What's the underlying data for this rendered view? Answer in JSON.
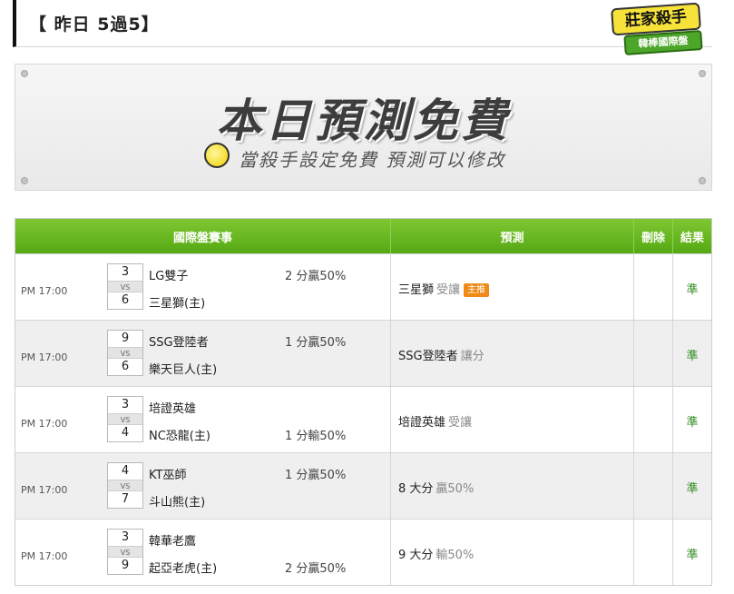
{
  "header": {
    "title": "【 昨日 5過5】"
  },
  "badge": {
    "line1": "莊家殺手",
    "line2": "韓棒國際盤"
  },
  "banner": {
    "title": "本日預測免費",
    "subtitle": "當殺手設定免費 預測可以修改"
  },
  "table": {
    "headers": {
      "match": "國際盤賽事",
      "prediction": "預測",
      "delete": "刪除",
      "result": "結果"
    },
    "rows": [
      {
        "time": "PM 17:00",
        "score1": "3",
        "score2": "6",
        "vs": "VS",
        "team1": "LG雙子",
        "team2": "三星獅(主)",
        "handicap1": "2 分贏50%",
        "handicap2": "",
        "pred_team": "三星獅",
        "pred_sub": "受讓",
        "pred_tag": "主推",
        "result": "準"
      },
      {
        "time": "PM 17:00",
        "score1": "9",
        "score2": "6",
        "vs": "VS",
        "team1": "SSG登陸者",
        "team2": "樂天巨人(主)",
        "handicap1": "1 分贏50%",
        "handicap2": "",
        "pred_team": "SSG登陸者",
        "pred_sub": "讓分",
        "pred_tag": "",
        "result": "準"
      },
      {
        "time": "PM 17:00",
        "score1": "3",
        "score2": "4",
        "vs": "VS",
        "team1": "培證英雄",
        "team2": "NC恐龍(主)",
        "handicap1": "",
        "handicap2": "1 分輸50%",
        "pred_team": "培證英雄",
        "pred_sub": "受讓",
        "pred_tag": "",
        "result": "準"
      },
      {
        "time": "PM 17:00",
        "score1": "4",
        "score2": "7",
        "vs": "VS",
        "team1": "KT巫師",
        "team2": "斗山熊(主)",
        "handicap1": "1 分贏50%",
        "handicap2": "",
        "pred_team": "8 大分",
        "pred_sub": "贏50%",
        "pred_tag": "",
        "result": "準"
      },
      {
        "time": "PM 17:00",
        "score1": "3",
        "score2": "9",
        "vs": "VS",
        "team1": "韓華老鷹",
        "team2": "起亞老虎(主)",
        "handicap1": "",
        "handicap2": "2 分贏50%",
        "pred_team": "9 大分",
        "pred_sub": "輸50%",
        "pred_tag": "",
        "result": "準"
      }
    ]
  }
}
